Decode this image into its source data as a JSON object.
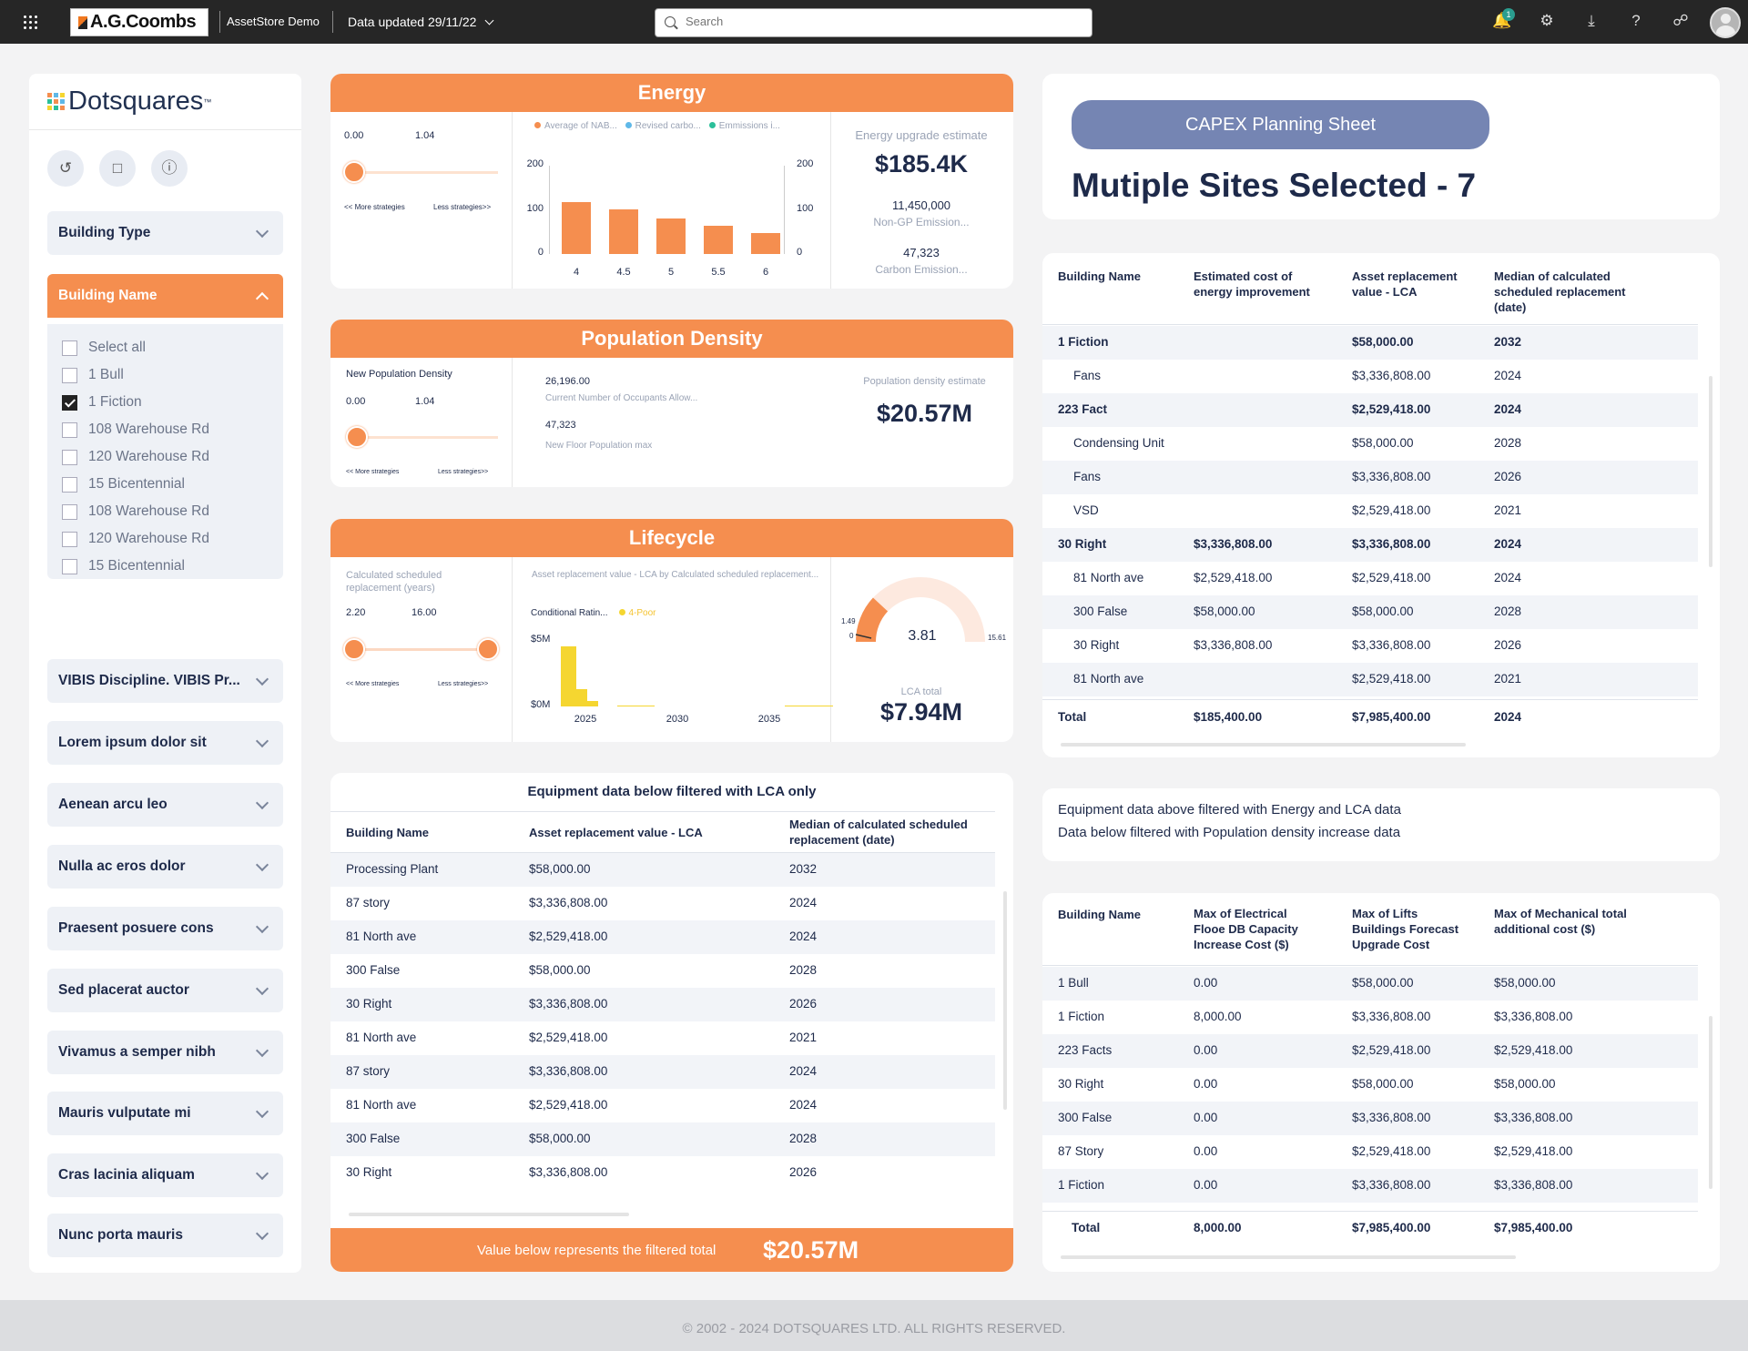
{
  "topbar": {
    "brand": "A.G.Coombs",
    "app_name": "AssetStore Demo",
    "data_updated": "Data updated 29/11/22",
    "search_placeholder": "Search",
    "notification_count": "1"
  },
  "sidebar": {
    "brand": "Dotsquares",
    "trademark": "™",
    "building_type_label": "Building Type",
    "building_name_label": "Building Name",
    "building_names": [
      {
        "label": "Select all",
        "checked": false
      },
      {
        "label": "1 Bull",
        "checked": false
      },
      {
        "label": "1 Fiction",
        "checked": true
      },
      {
        "label": "108 Warehouse Rd",
        "checked": false
      },
      {
        "label": "120 Warehouse Rd",
        "checked": false
      },
      {
        "label": "15 Bicentennial",
        "checked": false
      },
      {
        "label": "108 Warehouse Rd",
        "checked": false
      },
      {
        "label": "120 Warehouse Rd",
        "checked": false
      },
      {
        "label": "15 Bicentennial",
        "checked": false
      }
    ],
    "filters": [
      "VIBIS Discipline. VIBIS Pr...",
      "Lorem ipsum dolor sit",
      "Aenean arcu leo",
      "Nulla ac eros dolor",
      "Praesent posuere cons",
      "Sed placerat auctor",
      "Vivamus a semper nibh",
      "Mauris vulputate mi",
      "Cras lacinia aliquam",
      "Nunc porta mauris"
    ]
  },
  "energy": {
    "title": "Energy",
    "slider_min": "0.00",
    "slider_max": "1.04",
    "slider_value": 0.0,
    "more": "<< More strategies",
    "less": "Less strategies>>",
    "legend": [
      "Average of NAB...",
      "Revised carbo...",
      "Emmissions i..."
    ],
    "estimate_label": "Energy upgrade estimate",
    "estimate_value": "$185.4K",
    "non_gp_value": "11,450,000",
    "non_gp_label": "Non-GP Emission...",
    "carbon_value": "47,323",
    "carbon_label": "Carbon Emission..."
  },
  "population": {
    "title": "Population Density",
    "slider_label": "New Population Density",
    "slider_min": "0.00",
    "slider_max": "1.04",
    "slider_value": 0.0,
    "more": "<< More strategies",
    "less": "Less strategies>>",
    "occupants_value": "26,196.00",
    "occupants_label": "Current Number of Occupants Allow...",
    "floor_value": "47,323",
    "floor_label": "New Floor Population max",
    "estimate_label": "Population density estimate",
    "estimate_value": "$20.57M"
  },
  "lifecycle": {
    "title": "Lifecycle",
    "slider_label": "Calculated scheduled replacement (years)",
    "slider_min": "2.20",
    "slider_max": "16.00",
    "more": "<< More strategies",
    "less": "Less strategies>>",
    "chart_title": "Asset replacement value - LCA by Calculated scheduled replacement...",
    "legend_field": "Conditional Ratin...",
    "legend_item": "4-Poor",
    "gauge_min": "1.49",
    "gauge_zero": "0",
    "gauge_max": "15.61",
    "gauge_value": "3.81",
    "lca_label": "LCA total",
    "lca_value": "$7.94M"
  },
  "chart_data": [
    {
      "type": "bar",
      "x": [
        4,
        4.5,
        5,
        5.5,
        6
      ],
      "values": [
        117,
        102,
        80,
        63,
        47
      ],
      "ylim": [
        0,
        200
      ],
      "y_ticks": [
        "200",
        "100",
        "0"
      ],
      "y2_ticks": [
        "200",
        "100",
        "0"
      ],
      "x_ticks": [
        "4",
        "4.5",
        "5",
        "5.5",
        "6"
      ],
      "color": "#f58e4f",
      "legend_colors": [
        "#f58e4f",
        "#5fb8e8",
        "#2bbf9a"
      ]
    },
    {
      "type": "bar",
      "x": [
        2023.5,
        2024,
        2024.5,
        2025,
        2025.5,
        2026,
        2026.5,
        2027,
        2027.5,
        2028,
        2028.5,
        2029,
        2029.5,
        2030,
        2030.5,
        2031,
        2031.5,
        2032,
        2032.5,
        2033,
        2033.5,
        2034,
        2034.5,
        2035
      ],
      "values": [
        5.1,
        1.5,
        0.5,
        0,
        0,
        0.1,
        0.1,
        0.1,
        0,
        0,
        0,
        0,
        0,
        0,
        0,
        0,
        0,
        0,
        0,
        0,
        0.05,
        0.05,
        0.05,
        0.05
      ],
      "ylim": [
        0,
        6
      ],
      "y_ticks": [
        "$5M",
        "$0M"
      ],
      "x_ticks": [
        "2025",
        "2030",
        "2035"
      ],
      "series": [
        {
          "name": "4-Poor",
          "color": "#f5d630"
        }
      ]
    }
  ],
  "capex": {
    "button": "CAPEX Planning Sheet",
    "heading": "Mutiple Sites Selected - 7"
  },
  "table1": {
    "headers": [
      "Building Name",
      "Estimated cost of energy improvement",
      "Asset replacement value - LCA",
      "Median of calculated scheduled replacement (date)"
    ],
    "rows": [
      {
        "c": [
          "1 Fiction",
          "",
          "$58,000.00",
          "2032"
        ],
        "bold": true,
        "indent": false
      },
      {
        "c": [
          "Fans",
          "",
          "$3,336,808.00",
          "2024"
        ],
        "bold": false,
        "indent": true
      },
      {
        "c": [
          "223 Fact",
          "",
          "$2,529,418.00",
          "2024"
        ],
        "bold": true,
        "indent": false
      },
      {
        "c": [
          "Condensing Unit",
          "",
          "$58,000.00",
          "2028"
        ],
        "bold": false,
        "indent": true
      },
      {
        "c": [
          "Fans",
          "",
          "$3,336,808.00",
          "2026"
        ],
        "bold": false,
        "indent": true
      },
      {
        "c": [
          "VSD",
          "",
          "$2,529,418.00",
          "2021"
        ],
        "bold": false,
        "indent": true
      },
      {
        "c": [
          "30 Right",
          "$3,336,808.00",
          "$3,336,808.00",
          "2024"
        ],
        "bold": true,
        "indent": false
      },
      {
        "c": [
          "81 North ave",
          "$2,529,418.00",
          "$2,529,418.00",
          "2024"
        ],
        "bold": false,
        "indent": true
      },
      {
        "c": [
          "300 False",
          "$58,000.00",
          "$58,000.00",
          "2028"
        ],
        "bold": false,
        "indent": true
      },
      {
        "c": [
          "30 Right",
          "$3,336,808.00",
          "$3,336,808.00",
          "2026"
        ],
        "bold": false,
        "indent": true
      },
      {
        "c": [
          "81 North ave",
          "",
          "$2,529,418.00",
          "2021"
        ],
        "bold": false,
        "indent": true
      }
    ],
    "total": [
      "Total",
      "$185,400.00",
      "$7,985,400.00",
      "2024"
    ]
  },
  "note": {
    "line1": "Equipment data above filtered with Energy and LCA data",
    "line2": "Data below filtered with Population density increase data"
  },
  "table2": {
    "headers": [
      "Building Name",
      "Max of Electrical Flooe DB Capacity Increase Cost ($)",
      "Max of Lifts Buildings Forecast Upgrade Cost",
      "Max of Mechanical total additional cost ($)"
    ],
    "rows": [
      [
        "1 Bull",
        "0.00",
        "$58,000.00",
        "$58,000.00"
      ],
      [
        "1 Fiction",
        "8,000.00",
        "$3,336,808.00",
        "$3,336,808.00"
      ],
      [
        "223 Facts",
        "0.00",
        "$2,529,418.00",
        "$2,529,418.00"
      ],
      [
        "30 Right",
        "0.00",
        "$58,000.00",
        "$58,000.00"
      ],
      [
        "300 False",
        "0.00",
        "$3,336,808.00",
        "$3,336,808.00"
      ],
      [
        "87 Story",
        "0.00",
        "$2,529,418.00",
        "$2,529,418.00"
      ],
      [
        "1 Fiction",
        "0.00",
        "$3,336,808.00",
        "$3,336,808.00"
      ]
    ],
    "total": [
      "Total",
      "8,000.00",
      "$7,985,400.00",
      "$7,985,400.00"
    ]
  },
  "equipment": {
    "title": "Equipment data below filtered with LCA only",
    "headers": [
      "Building Name",
      "Asset replacement value - LCA",
      "Median of calculated scheduled replacement (date)"
    ],
    "rows": [
      [
        "Processing Plant",
        "$58,000.00",
        "2032"
      ],
      [
        "87 story",
        "$3,336,808.00",
        "2024"
      ],
      [
        "81 North ave",
        "$2,529,418.00",
        "2024"
      ],
      [
        "300 False",
        "$58,000.00",
        "2028"
      ],
      [
        "30 Right",
        "$3,336,808.00",
        "2026"
      ],
      [
        "81 North ave",
        "$2,529,418.00",
        "2021"
      ],
      [
        "87 story",
        "$3,336,808.00",
        "2024"
      ],
      [
        "81 North ave",
        "$2,529,418.00",
        "2024"
      ],
      [
        "300 False",
        "$58,000.00",
        "2028"
      ],
      [
        "30 Right",
        "$3,336,808.00",
        "2026"
      ]
    ],
    "footer_label": "Value below represents the filtered total",
    "footer_value": "$20.57M"
  },
  "footer": "© 2002 - 2024 DOTSQUARES LTD. ALL RIGHTS RESERVED.",
  "colors": {
    "accent": "#f58e4f",
    "navy": "#1e2a4a",
    "capex": "#7585b3"
  }
}
